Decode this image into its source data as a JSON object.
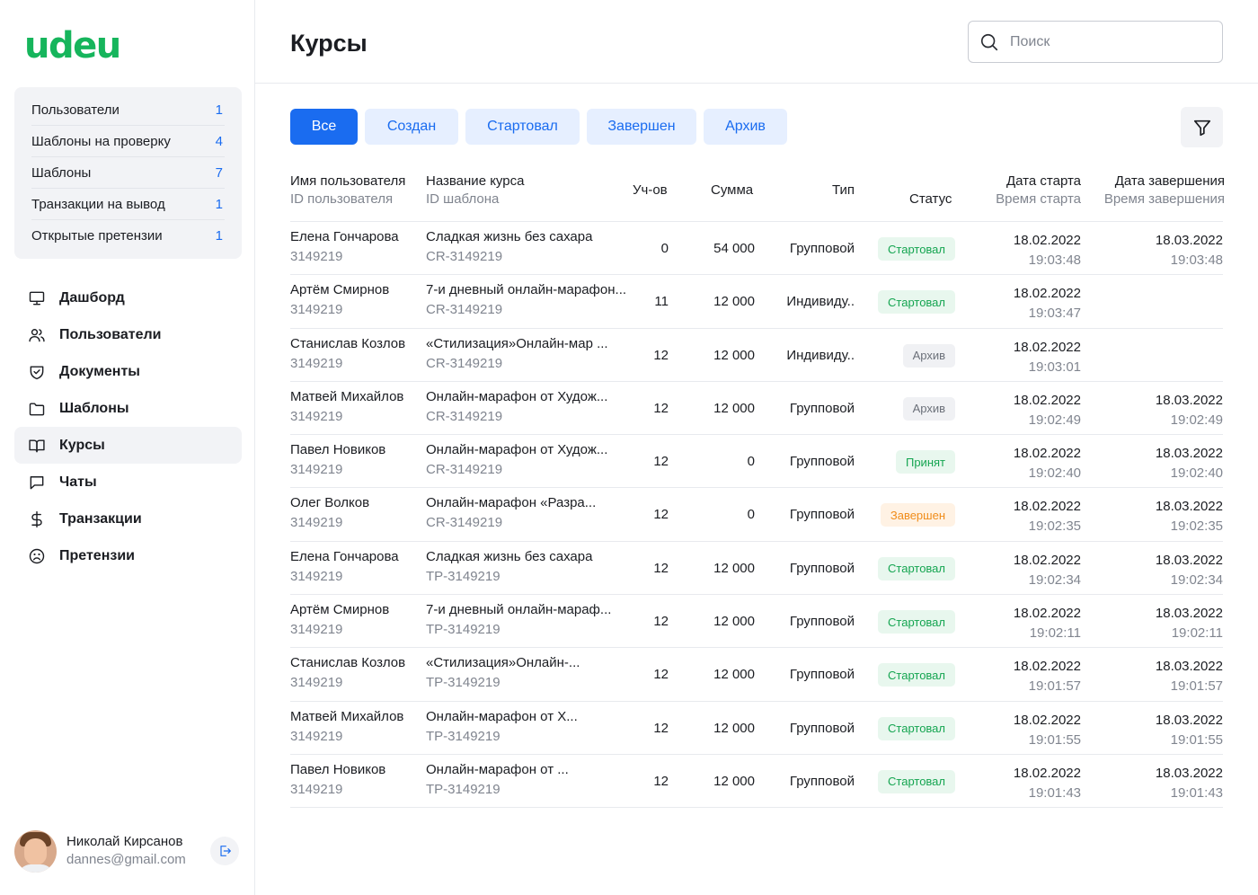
{
  "app": {
    "logo": "udeu"
  },
  "quick_stats": [
    {
      "label": "Пользователи",
      "count": "1"
    },
    {
      "label": "Шаблоны на проверку",
      "count": "4"
    },
    {
      "label": "Шаблоны",
      "count": "7"
    },
    {
      "label": "Транзакции на вывод",
      "count": "1"
    },
    {
      "label": "Открытые претензии",
      "count": "1"
    }
  ],
  "nav": [
    {
      "label": "Дашборд",
      "icon": "monitor-icon"
    },
    {
      "label": "Пользователи",
      "icon": "users-icon"
    },
    {
      "label": "Документы",
      "icon": "shield-icon"
    },
    {
      "label": "Шаблоны",
      "icon": "folder-icon"
    },
    {
      "label": "Курсы",
      "icon": "book-icon",
      "active": true
    },
    {
      "label": "Чаты",
      "icon": "chat-icon"
    },
    {
      "label": "Транзакции",
      "icon": "dollar-icon"
    },
    {
      "label": "Претензии",
      "icon": "sad-face-icon"
    }
  ],
  "user": {
    "name": "Николай Кирсанов",
    "email": "dannes@gmail.com"
  },
  "header": {
    "title": "Курсы",
    "search_placeholder": "Поиск"
  },
  "tabs": [
    {
      "label": "Все",
      "active": true
    },
    {
      "label": "Создан"
    },
    {
      "label": "Стартовал"
    },
    {
      "label": "Завершен"
    },
    {
      "label": "Архив"
    }
  ],
  "columns": {
    "user": "Имя пользователя",
    "user_sub": "ID пользователя",
    "course": "Название курса",
    "course_sub": "ID шаблона",
    "participants": "Уч-ов",
    "sum": "Сумма",
    "type": "Тип",
    "status": "Статус",
    "start": "Дата старта",
    "start_sub": "Время старта",
    "end": "Дата завершения",
    "end_sub": "Время завершения"
  },
  "colors": {
    "accent": "#1a6cf0",
    "brand": "#16b55c",
    "status_green": "#15a551",
    "status_orange": "#f08c1a",
    "status_gray": "#6b7079"
  },
  "rows": [
    {
      "user": "Елена Гончарова",
      "user_id": "3149219",
      "course": "Сладкая жизнь без сахара",
      "template_id": "CR-3149219",
      "participants": "0",
      "sum": "54 000",
      "type": "Групповой",
      "status": "Стартовал",
      "status_color": "green",
      "start_date": "18.02.2022",
      "start_time": "19:03:48",
      "end_date": "18.03.2022",
      "end_time": "19:03:48"
    },
    {
      "user": "Артём Смирнов",
      "user_id": "3149219",
      "course": "7-и дневный онлайн-марафон...",
      "template_id": "CR-3149219",
      "participants": "11",
      "sum": "12 000",
      "type": "Индивиду..",
      "status": "Стартовал",
      "status_color": "green",
      "start_date": "18.02.2022",
      "start_time": "19:03:47",
      "end_date": "",
      "end_time": ""
    },
    {
      "user": "Станислав Козлов",
      "user_id": "3149219",
      "course": "«Стилизация»Онлайн-мар ...",
      "template_id": "CR-3149219",
      "participants": "12",
      "sum": "12 000",
      "type": "Индивиду..",
      "status": "Архив",
      "status_color": "gray",
      "start_date": "18.02.2022",
      "start_time": "19:03:01",
      "end_date": "",
      "end_time": ""
    },
    {
      "user": "Матвей Михайлов",
      "user_id": "3149219",
      "course": "Онлайн-марафон от Худож...",
      "template_id": "CR-3149219",
      "participants": "12",
      "sum": "12 000",
      "type": "Групповой",
      "status": "Архив",
      "status_color": "gray",
      "start_date": "18.02.2022",
      "start_time": "19:02:49",
      "end_date": "18.03.2022",
      "end_time": "19:02:49"
    },
    {
      "user": "Павел Новиков",
      "user_id": "3149219",
      "course": "Онлайн-марафон от Худож...",
      "template_id": "CR-3149219",
      "participants": "12",
      "sum": "0",
      "type": "Групповой",
      "status": "Принят",
      "status_color": "green",
      "start_date": "18.02.2022",
      "start_time": "19:02:40",
      "end_date": "18.03.2022",
      "end_time": "19:02:40"
    },
    {
      "user": "Олег Волков",
      "user_id": "3149219",
      "course": "Онлайн-марафон «Разра...",
      "template_id": "CR-3149219",
      "participants": "12",
      "sum": "0",
      "type": "Групповой",
      "status": "Завершен",
      "status_color": "orange",
      "start_date": "18.02.2022",
      "start_time": "19:02:35",
      "end_date": "18.03.2022",
      "end_time": "19:02:35"
    },
    {
      "user": "Елена Гончарова",
      "user_id": "3149219",
      "course": "Сладкая жизнь без сахара",
      "template_id": "TP-3149219",
      "participants": "12",
      "sum": "12 000",
      "type": "Групповой",
      "status": "Стартовал",
      "status_color": "green",
      "start_date": "18.02.2022",
      "start_time": "19:02:34",
      "end_date": "18.03.2022",
      "end_time": "19:02:34"
    },
    {
      "user": "Артём Смирнов",
      "user_id": "3149219",
      "course": "7-и дневный онлайн-мараф...",
      "template_id": "TP-3149219",
      "participants": "12",
      "sum": "12 000",
      "type": "Групповой",
      "status": "Стартовал",
      "status_color": "green",
      "start_date": "18.02.2022",
      "start_time": "19:02:11",
      "end_date": "18.03.2022",
      "end_time": "19:02:11"
    },
    {
      "user": "Станислав Козлов",
      "user_id": "3149219",
      "course": "«Стилизация»Онлайн-...",
      "template_id": "TP-3149219",
      "participants": "12",
      "sum": "12 000",
      "type": "Групповой",
      "status": "Стартовал",
      "status_color": "green",
      "start_date": "18.02.2022",
      "start_time": "19:01:57",
      "end_date": "18.03.2022",
      "end_time": "19:01:57"
    },
    {
      "user": "Матвей Михайлов",
      "user_id": "3149219",
      "course": "Онлайн-марафон от Х...",
      "template_id": "TP-3149219",
      "participants": "12",
      "sum": "12 000",
      "type": "Групповой",
      "status": "Стартовал",
      "status_color": "green",
      "start_date": "18.02.2022",
      "start_time": "19:01:55",
      "end_date": "18.03.2022",
      "end_time": "19:01:55"
    },
    {
      "user": "Павел Новиков",
      "user_id": "3149219",
      "course": "Онлайн-марафон от ...",
      "template_id": "TP-3149219",
      "participants": "12",
      "sum": "12 000",
      "type": "Групповой",
      "status": "Стартовал",
      "status_color": "green",
      "start_date": "18.02.2022",
      "start_time": "19:01:43",
      "end_date": "18.03.2022",
      "end_time": "19:01:43"
    }
  ]
}
